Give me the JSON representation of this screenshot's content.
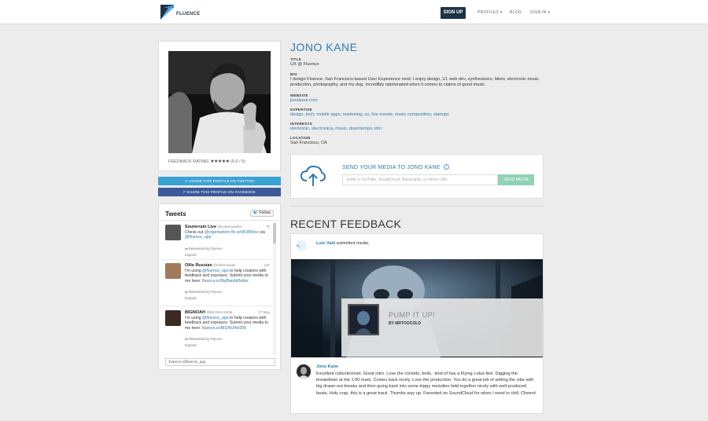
{
  "header": {
    "logo_text": "FLUENCE",
    "signup_label": "SIGN UP",
    "nav": [
      {
        "label": "PROFILES ▾"
      },
      {
        "label": "BLOG"
      },
      {
        "label": "SIGN IN ▾"
      }
    ]
  },
  "profile": {
    "name": "JONO KANE",
    "rating_label": "FEEDBACK RATING",
    "rating_stars": "★★★★★",
    "rating_value": "(5.0 / 5)",
    "rating": 5.0,
    "share_twitter": "SHARE THIS PROFILE ON TWITTER",
    "share_facebook": "SHARE THIS PROFILE ON FACEBOOK",
    "fields": {
      "title_label": "TITLE",
      "title": "UX @ Fluence",
      "bio_label": "BIO",
      "bio": "I design Fluence. San Francisco-based User Experience nerd. I enjoy design, UI, web dev, synthesizers, bikes, electronic music production, photography, and my dog. Incredibly opinionated when it comes to claims of good music.",
      "website_label": "WEBSITE",
      "website": "jonokane.com",
      "expertise_label": "EXPERTISE",
      "expertise": [
        "design",
        "tech",
        "mobile apps",
        "marketing",
        "ux",
        "live events",
        "music composition",
        "startups"
      ],
      "interests_label": "INTERESTS",
      "interests": [
        "electronic",
        "electronica",
        "music",
        "downtempo",
        "idm"
      ],
      "location_label": "LOCATION",
      "location": "San Francisco, CA"
    }
  },
  "tweets": {
    "title": "Tweets",
    "follow_label": "Follow",
    "compose_placeholder": "Tweet to @fluence_app",
    "items": [
      {
        "name": "Souterrain Live",
        "handle": "@souterrainlive",
        "time": "7h",
        "text_pre": "Check out ",
        "link1": "@rogerkahlon",
        "text_mid": " ",
        "link2": "fln.io/WOBWxx",
        "text_mid2": " via ",
        "link3": "@fluence_app",
        "retweet": "Retweeted by Fluence",
        "expand": "Expand"
      },
      {
        "name": "Ollie Russian",
        "handle": "@Ollierussian",
        "time": "14h",
        "text_pre": "I'm using ",
        "link1": "@fluence_app",
        "text_mid": " to help creators with feedback and exposure. Submit your media to me here: ",
        "link2": "fluence.io/MyBandsBetter",
        "retweet": "Retweeted by Fluence",
        "expand": "Expand"
      },
      {
        "name": "BIGNOAH",
        "handle": "@BIGNOAH256",
        "time": "27 May",
        "text_pre": "I'm using ",
        "link1": "@fluence_app",
        "text_mid": " to help creators with feedback and exposure. Submit your media to me here: ",
        "link2": "fluence.io/BIGNOAH256",
        "retweet": "Retweeted by Fluence",
        "expand": "Expand"
      }
    ]
  },
  "send_media": {
    "title": "SEND YOUR MEDIA TO JONO KANE",
    "help": "?",
    "placeholder": "Enter a YouTube, SoundCloud, Bandcamp, or Vimeo URL",
    "button": "SEND MEDIA"
  },
  "feedback": {
    "title": "RECENT FEEDBACK",
    "actor": "Luis Vadi",
    "action": " submitted media.",
    "track_title": "PUMP IT UP!",
    "track_artist": "BY MRTOOCOLD",
    "commenter": "Jono Kane",
    "comment": "Excellent collection/set. Great intro. Love the crickets, bells.. kind of has a Flying Lotus feel. Digging the breakdown at the 1:00 mark. Comes back nicely. Love the production. You do a great job of setting the vibe with big drawn-out breaks and then going back into some trippy melodies held together nicely with well-produced beats. Holy crap, this is a great track. Thumbs way up. Favorited on SoundCloud for when I need to chill. Cheers!"
  },
  "colors": {
    "accent": "#2f7ab3",
    "twitter": "#3aa3d4",
    "facebook": "#3b5998",
    "send": "#8fd3b4",
    "nav_dark": "#1d3346"
  }
}
